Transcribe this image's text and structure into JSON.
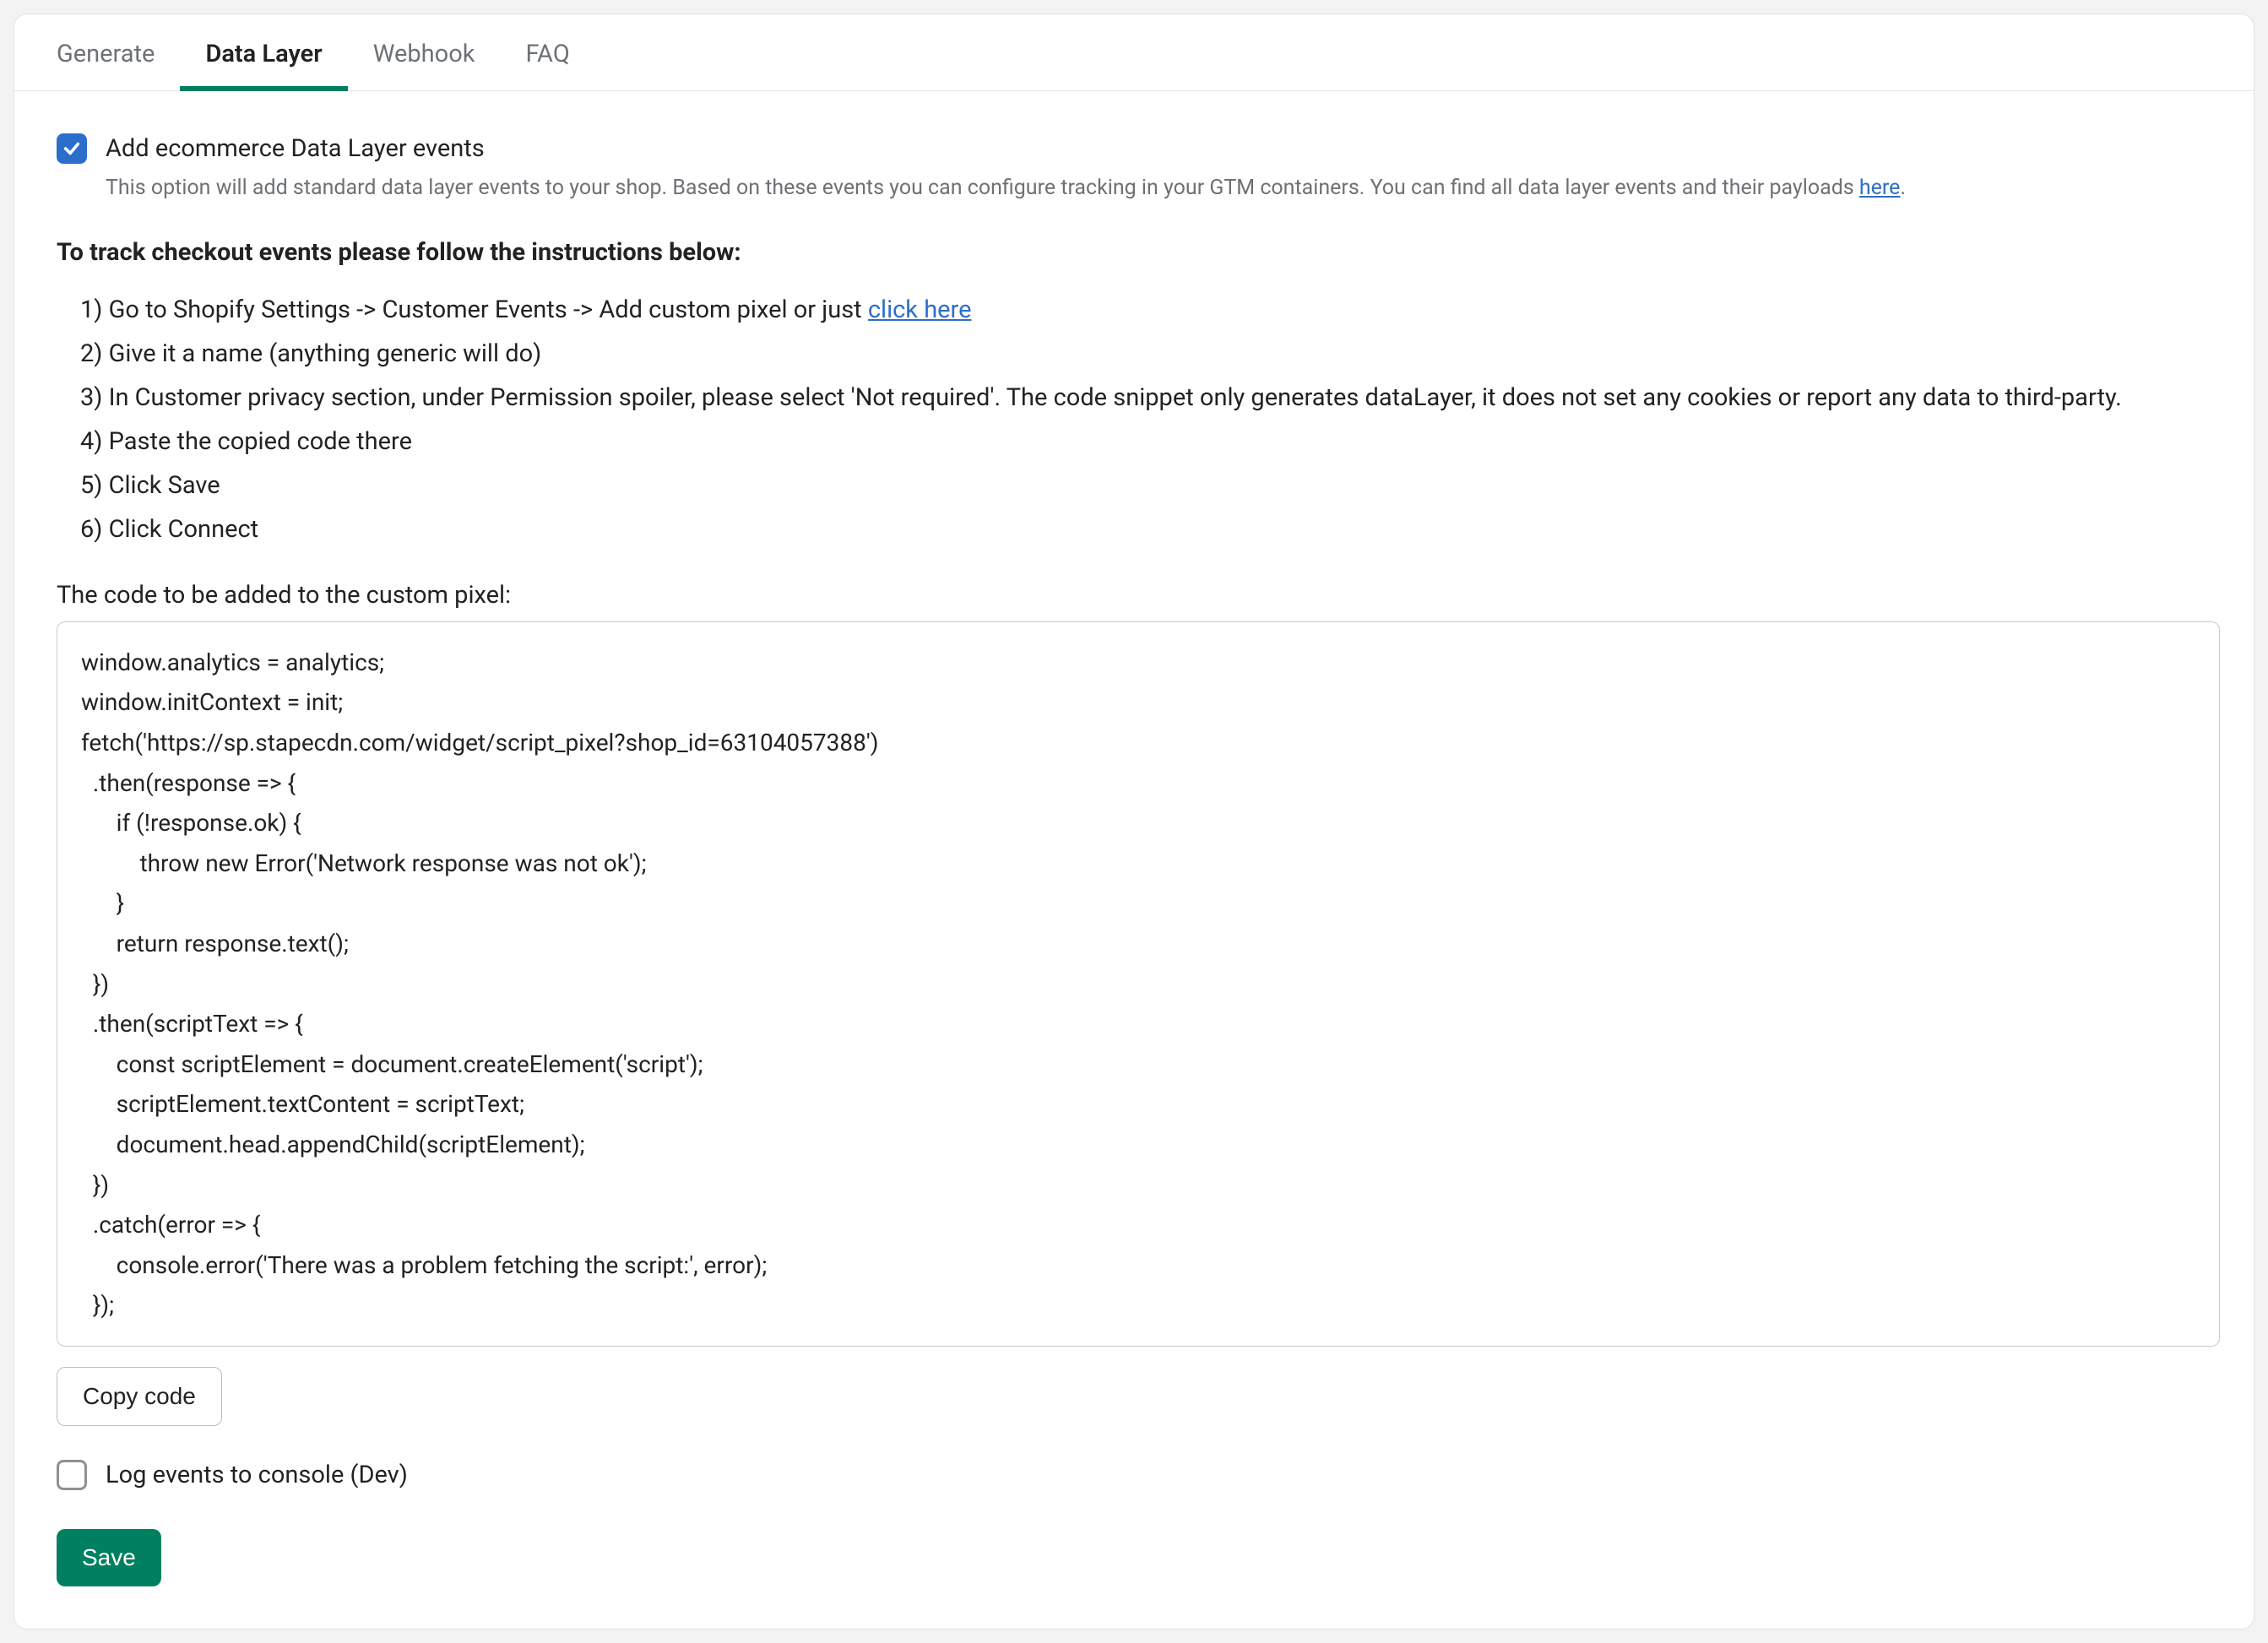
{
  "tabs": {
    "generate": "Generate",
    "data_layer": "Data Layer",
    "webhook": "Webhook",
    "faq": "FAQ"
  },
  "add_events": {
    "label": "Add ecommerce Data Layer events",
    "helper_pre": "This option will add standard data layer events to your shop. Based on these events you can configure tracking in your GTM containers. You can find all data layer events and their payloads ",
    "helper_link": "here",
    "helper_post": "."
  },
  "instructions_heading": "To track checkout events please follow the instructions below:",
  "steps": {
    "s1_pre": "1) Go to Shopify Settings -> Customer Events -> Add custom pixel or just ",
    "s1_link": "click here",
    "s2": "2) Give it a name (anything generic will do)",
    "s3": "3) In Customer privacy section, under Permission spoiler, please select 'Not required'. The code snippet only generates dataLayer, it does not set any cookies or report any data to third-party.",
    "s4": "4) Paste the copied code there",
    "s5": "5) Click Save",
    "s6": "6) Click Connect"
  },
  "code_label": "The code to be added to the custom pixel:",
  "code_block": "window.analytics = analytics;\nwindow.initContext = init;\nfetch('https://sp.stapecdn.com/widget/script_pixel?shop_id=63104057388')\n  .then(response => {\n      if (!response.ok) {\n          throw new Error('Network response was not ok');\n      }\n      return response.text();\n  })\n  .then(scriptText => {\n      const scriptElement = document.createElement('script');\n      scriptElement.textContent = scriptText;\n      document.head.appendChild(scriptElement);\n  })\n  .catch(error => {\n      console.error('There was a problem fetching the script:', error);\n  });",
  "buttons": {
    "copy_code": "Copy code",
    "save": "Save"
  },
  "log_events_label": "Log events to console (Dev)"
}
